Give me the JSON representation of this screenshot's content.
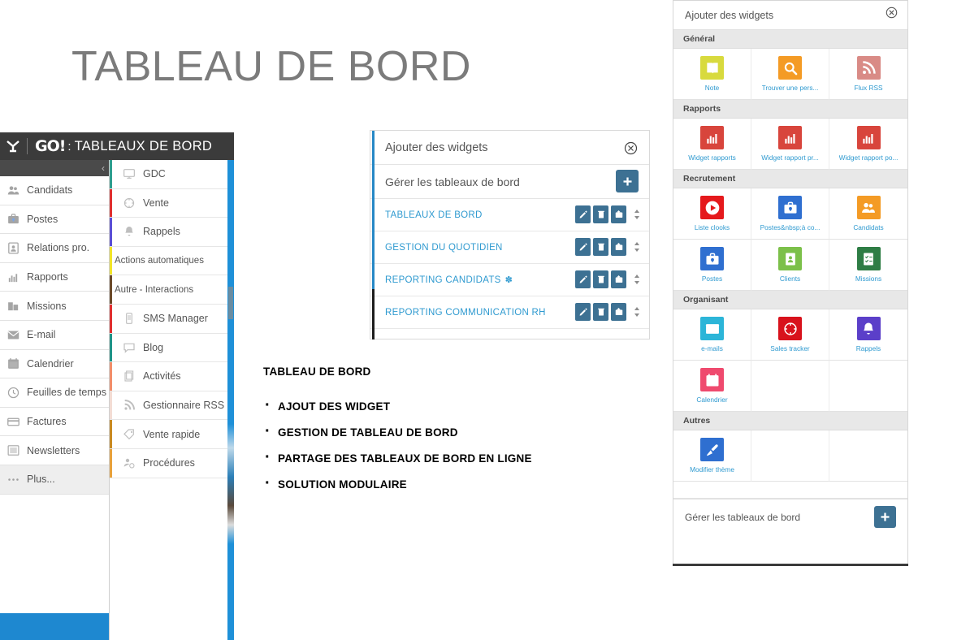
{
  "slide": {
    "title": "TABLEAU DE BORD",
    "body_heading": "TABLEAU DE BORD",
    "bullets": [
      "AJOUT DES WIDGET",
      "GESTION DE TABLEAU DE BORD",
      "PARTAGE DES TABLEAUX DE BORD EN LIGNE",
      "SOLUTION MODULAIRE"
    ]
  },
  "left_capture": {
    "topbar": {
      "brand": "GO!",
      "separator": ":",
      "title": "TABLEAUX DE BORD"
    },
    "collapse_icon": "chevron-left-icon",
    "nav_items": [
      {
        "label": "Candidats",
        "icon": "users-icon",
        "active": false
      },
      {
        "label": "Postes",
        "icon": "briefcase-icon",
        "active": false
      },
      {
        "label": "Relations pro.",
        "icon": "contact-card-icon",
        "active": false
      },
      {
        "label": "Rapports",
        "icon": "bar-chart-icon",
        "active": false
      },
      {
        "label": "Missions",
        "icon": "buildings-icon",
        "active": false
      },
      {
        "label": "E-mail",
        "icon": "envelope-icon",
        "active": false
      },
      {
        "label": "Calendrier",
        "icon": "calendar-icon",
        "active": false
      },
      {
        "label": "Feuilles de temps",
        "icon": "clock-icon",
        "active": false
      },
      {
        "label": "Factures",
        "icon": "credit-card-icon",
        "active": false
      },
      {
        "label": "Newsletters",
        "icon": "newsletter-icon",
        "active": false
      },
      {
        "label": "Plus...",
        "icon": "ellipsis-icon",
        "active": true
      }
    ],
    "submenu_items": [
      {
        "label": "GDC",
        "icon": "monitor-icon",
        "stripe": "#2e9e8f"
      },
      {
        "label": "Vente",
        "icon": "target-icon",
        "stripe": "#e03030"
      },
      {
        "label": "Rappels",
        "icon": "bell-icon",
        "stripe": "#5b4fd6"
      },
      {
        "label": "Actions automatiques",
        "icon": "network-icon",
        "stripe": "#f2e52a"
      },
      {
        "label": "Autre - Interactions",
        "icon": "note-edit-icon",
        "stripe": "#6b4a2a"
      },
      {
        "label": "SMS Manager",
        "icon": "mobile-icon",
        "stripe": "#e03030"
      },
      {
        "label": "Blog",
        "icon": "speech-bubble-icon",
        "stripe": "#1f9488"
      },
      {
        "label": "Activités",
        "icon": "pages-icon",
        "stripe": "#f28e6a"
      },
      {
        "label": "Gestionnaire RSS",
        "icon": "rss-icon",
        "stripe": "#f3dcd4"
      },
      {
        "label": "Vente rapide",
        "icon": "tag-icon",
        "stripe": "#c98a22"
      },
      {
        "label": "Procédures",
        "icon": "user-gear-icon",
        "stripe": "#e8a23c"
      }
    ],
    "accent_color": "#1e88d0"
  },
  "center_dialog": {
    "title": "Ajouter des widgets",
    "close_icon": "close-circle-icon",
    "manage_label": "Gérer les tableaux de bord",
    "add_button_icon": "plus-icon",
    "accent_color": "#2688c6",
    "button_color": "#3d7193",
    "row_action_icons": [
      "pencil-icon",
      "trash-icon",
      "share-icon",
      "sort-handle-icon"
    ],
    "dashboards": [
      {
        "name": "TABLEAUX DE BORD",
        "starred": false
      },
      {
        "name": "GESTION DU QUOTIDIEN",
        "starred": false
      },
      {
        "name": "REPORTING CANDIDATS",
        "starred": true,
        "star": "✽"
      },
      {
        "name": "REPORTING COMMUNICATION RH",
        "starred": false
      }
    ]
  },
  "widget_panel": {
    "title": "Ajouter des widgets",
    "close_icon": "close-circle-icon",
    "footer_label": "Gérer les tableaux de bord",
    "footer_button_icon": "plus-icon",
    "sections": [
      {
        "name": "Général",
        "widgets": [
          {
            "label": "Note",
            "icon": "note-book-icon",
            "color": "#d8da3e"
          },
          {
            "label": "Trouver une pers...",
            "icon": "magnifier-icon",
            "color": "#f49b25"
          },
          {
            "label": "Flux RSS",
            "icon": "rss-icon",
            "color": "#d98b86"
          }
        ]
      },
      {
        "name": "Rapports",
        "widgets": [
          {
            "label": "Widget rapports",
            "icon": "bar-chart-icon",
            "color": "#d8453c"
          },
          {
            "label": "Widget rapport pr...",
            "icon": "bar-chart-icon",
            "color": "#d8453c"
          },
          {
            "label": "Widget rapport po...",
            "icon": "bar-chart-icon",
            "color": "#d8453c"
          }
        ]
      },
      {
        "name": "Recrutement",
        "widgets": [
          {
            "label": "Liste clooks",
            "icon": "play-circle-icon",
            "color": "#e5191c"
          },
          {
            "label": "Postes&nbsp;à co...",
            "icon": "briefcase-icon",
            "color": "#2f6fd0"
          },
          {
            "label": "Candidats",
            "icon": "users-icon",
            "color": "#f49b25"
          },
          {
            "label": "Postes",
            "icon": "briefcase-icon",
            "color": "#2f6fd0"
          },
          {
            "label": "Clients",
            "icon": "address-book-icon",
            "color": "#7cc04a"
          },
          {
            "label": "Missions",
            "icon": "checklist-icon",
            "color": "#2e7d45"
          }
        ]
      },
      {
        "name": "Organisant",
        "widgets": [
          {
            "label": "e-mails",
            "icon": "envelope-icon",
            "color": "#2cb5d8"
          },
          {
            "label": "Sales tracker",
            "icon": "target-icon",
            "color": "#d8121c"
          },
          {
            "label": "Rappels",
            "icon": "bell-icon",
            "color": "#5b3fc9"
          },
          {
            "label": "Calendrier",
            "icon": "calendar-icon",
            "color": "#ef4a6e"
          }
        ]
      },
      {
        "name": "Autres",
        "widgets": [
          {
            "label": "Modifier thème",
            "icon": "paintbrush-icon",
            "color": "#2f6fd0"
          }
        ]
      }
    ]
  }
}
